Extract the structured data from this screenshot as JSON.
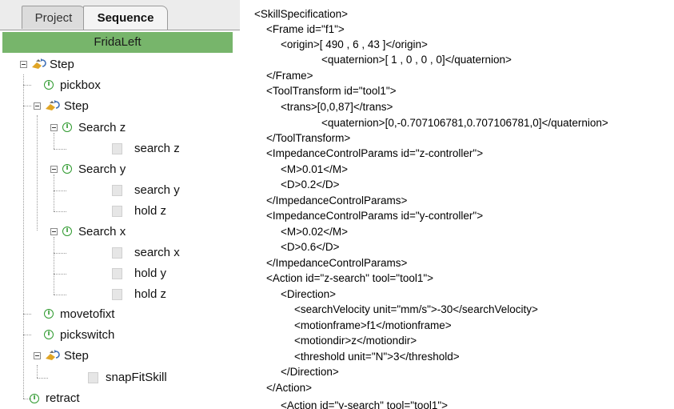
{
  "tabs": {
    "project": "Project",
    "sequence": "Sequence"
  },
  "header": {
    "title": "FridaLeft"
  },
  "tree": {
    "step1": "Step",
    "pickbox": "pickbox",
    "step2": "Step",
    "search_z": "Search z",
    "search_z_child": "search z",
    "search_y": "Search y",
    "search_y_child": "search y",
    "hold_z_1": "hold z",
    "search_x": "Search x",
    "search_x_child": "search x",
    "hold_y": "hold y",
    "hold_z_2": "hold z",
    "movetofixt": "movetofixt",
    "pickswitch": "pickswitch",
    "step3": "Step",
    "snapfitskill": "snapFitSkill",
    "retract": "retract"
  },
  "xml_lines": [
    "<SkillSpecification>",
    "<Frame id=\"f1\">",
    "<origin>[ 490 , 6 , 43 ]</origin>",
    "<quaternion>[ 1 , 0 , 0 , 0]</quaternion>",
    "</Frame>",
    "<ToolTransform id=\"tool1\">",
    "<trans>[0,0,87]</trans>",
    "<quaternion>[0,-0.707106781,0.707106781,0]</quaternion>",
    "</ToolTransform>",
    "<ImpedanceControlParams id=\"z-controller\">",
    "<M>0.01</M>",
    "<D>0.2</D>",
    "</ImpedanceControlParams>",
    "<ImpedanceControlParams id=\"y-controller\">",
    "<M>0.02</M>",
    "<D>0.6</D>",
    "</ImpedanceControlParams>",
    "<Action id=\"z-search\" tool=\"tool1\">",
    "<Direction>",
    "<searchVelocity unit=\"mm/s\">-30</searchVelocity>",
    "<motionframe>f1</motionframe>",
    "<motiondir>z</motiondir>",
    "<threshold unit=\"N\">3</threshold>",
    "</Direction>",
    "</Action>",
    "<Action id=\"y-search\" tool=\"tool1\">"
  ],
  "colors": {
    "header_bg": "#77b56b",
    "info_icon": "#2f9a2f"
  }
}
